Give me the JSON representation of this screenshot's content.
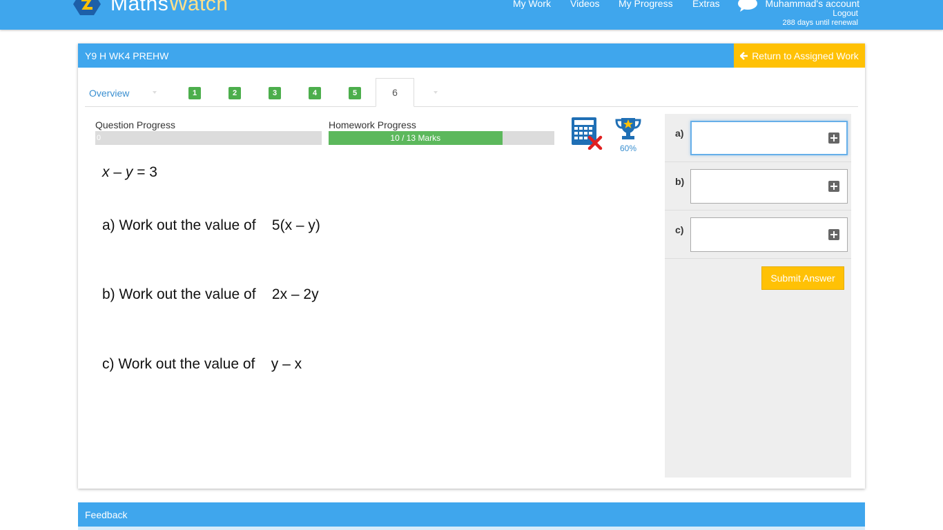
{
  "brand": {
    "part1": "Maths",
    "part2": "Watch"
  },
  "nav": {
    "items": [
      "My Work",
      "Videos",
      "My Progress",
      "Extras"
    ]
  },
  "account": {
    "name": "Muhammad's account",
    "logout": "Logout",
    "renewal": "288 days until renewal"
  },
  "panel": {
    "title": "Y9 H WK4 PREHW",
    "return_label": "Return to Assigned Work"
  },
  "tabs": {
    "overview": "Overview",
    "numbers": [
      "1",
      "2",
      "3",
      "4",
      "5"
    ],
    "active": "6"
  },
  "progress": {
    "question_label": "Question Progress",
    "question_value": "0",
    "question_fraction": 0,
    "homework_label": "Homework Progress",
    "homework_text": "10 / 13 Marks",
    "homework_fraction": 0.7692
  },
  "trophy": {
    "percent": "60%"
  },
  "question": {
    "given": {
      "pre": "x",
      "mid": " – ",
      "var2": "y",
      "post": " = 3"
    },
    "a": {
      "prefix": "a) Work out the value of",
      "expr": "5(x – y)"
    },
    "b": {
      "prefix": "b) Work out the value of",
      "expr": "2x – 2y"
    },
    "c": {
      "prefix": "c) Work out the value of",
      "expr": "y – x"
    }
  },
  "answers": {
    "labels": [
      "a)",
      "b)",
      "c)"
    ],
    "values": [
      "",
      "",
      ""
    ],
    "submit": "Submit Answer"
  },
  "feedback": {
    "title": "Feedback"
  },
  "colors": {
    "header": "#3fa6ed",
    "accent": "#ffc105",
    "success": "#5cb85c"
  }
}
